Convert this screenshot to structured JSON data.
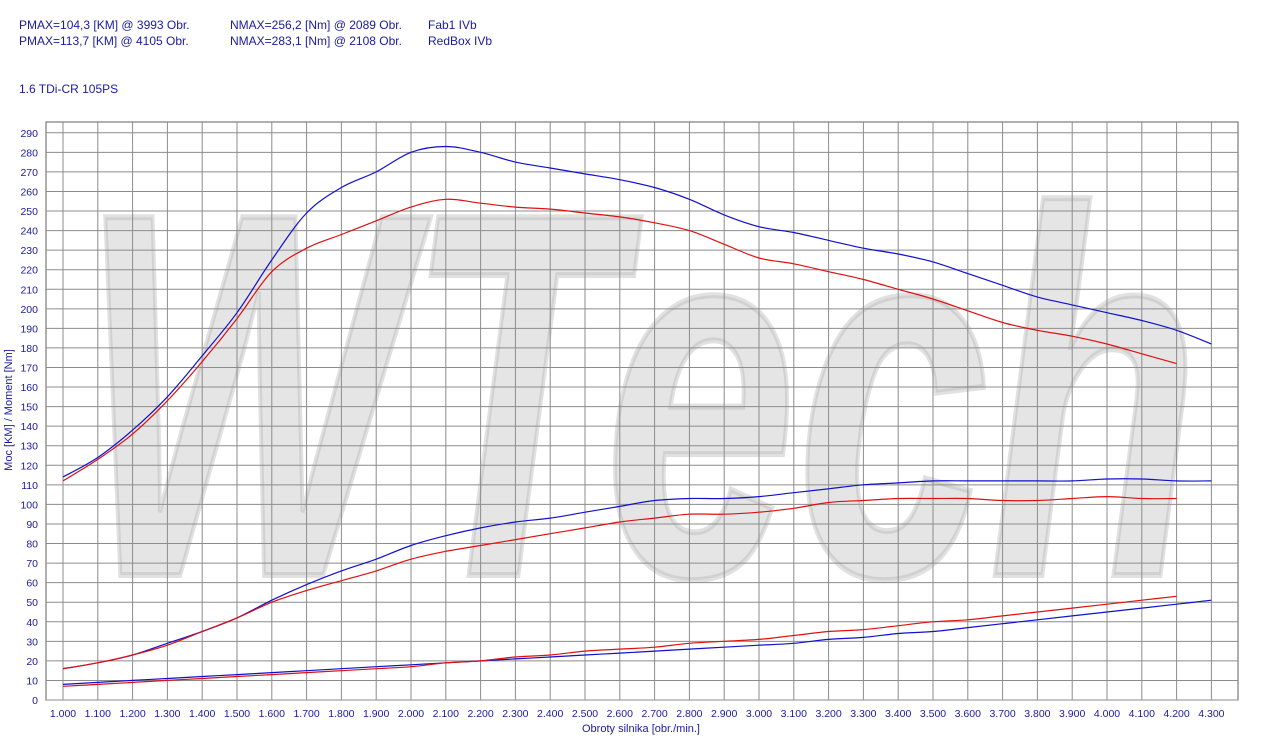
{
  "header": {
    "row1": {
      "pmax": "PMAX=104,3 [KM] @ 3993 Obr.",
      "nmax": "NMAX=256,2 [Nm] @ 2089 Obr.",
      "name": "Fab1 IVb"
    },
    "row2": {
      "pmax": "PMAX=113,7 [KM] @ 4105 Obr.",
      "nmax": "NMAX=283,1 [Nm] @ 2108 Obr.",
      "name": "RedBox IVb"
    },
    "engine": "1.6 TDi-CR 105PS"
  },
  "chart_data": {
    "type": "line",
    "xlabel": "Obroty silnika [obr./min.]",
    "ylabel": "Moc [KM] / Moment [Nm]",
    "xlim": [
      1.0,
      4.3
    ],
    "ylim": [
      0,
      290
    ],
    "x_ticks": [
      "1.000",
      "1.100",
      "1.200",
      "1.300",
      "1.400",
      "1.500",
      "1.600",
      "1.700",
      "1.800",
      "1.900",
      "2.000",
      "2.100",
      "2.200",
      "2.300",
      "2.400",
      "2.500",
      "2.600",
      "2.700",
      "2.800",
      "2.900",
      "3.000",
      "3.100",
      "3.200",
      "3.300",
      "3.400",
      "3.500",
      "3.600",
      "3.700",
      "3.800",
      "3.900",
      "4.000",
      "4.100",
      "4.200",
      "4.300"
    ],
    "y_ticks": [
      "0",
      "10",
      "20",
      "30",
      "40",
      "50",
      "60",
      "70",
      "80",
      "90",
      "100",
      "110",
      "120",
      "130",
      "140",
      "150",
      "160",
      "170",
      "180",
      "190",
      "200",
      "210",
      "220",
      "230",
      "240",
      "250",
      "260",
      "270",
      "280",
      "290"
    ],
    "grid": true,
    "watermark": "WTech",
    "colors": {
      "red": "#e01010",
      "blue": "#1010d0",
      "grid": "#8c8c8c",
      "axis_text": "#1a1aa0"
    },
    "series": [
      {
        "color": "#1010d0",
        "x": [
          1.0,
          1.1,
          1.2,
          1.3,
          1.4,
          1.5,
          1.6,
          1.7,
          1.8,
          1.9,
          2.0,
          2.1,
          2.2,
          2.3,
          2.4,
          2.5,
          2.6,
          2.7,
          2.8,
          2.9,
          3.0,
          3.1,
          3.2,
          3.3,
          3.4,
          3.5,
          3.6,
          3.7,
          3.8,
          3.9,
          4.0,
          4.1,
          4.2,
          4.3
        ],
        "y": [
          114,
          124,
          138,
          155,
          176,
          198,
          225,
          249,
          262,
          270,
          280,
          283,
          280,
          275,
          272,
          269,
          266,
          262,
          256,
          248,
          242,
          239,
          235,
          231,
          228,
          224,
          218,
          212,
          206,
          202,
          198,
          194,
          189,
          182
        ]
      },
      {
        "color": "#e01010",
        "x": [
          1.0,
          1.1,
          1.2,
          1.3,
          1.4,
          1.5,
          1.6,
          1.7,
          1.8,
          1.9,
          2.0,
          2.1,
          2.2,
          2.3,
          2.4,
          2.5,
          2.6,
          2.7,
          2.8,
          2.9,
          3.0,
          3.1,
          3.2,
          3.3,
          3.4,
          3.5,
          3.6,
          3.7,
          3.8,
          3.9,
          4.0,
          4.1,
          4.2
        ],
        "y": [
          112,
          123,
          136,
          153,
          173,
          195,
          219,
          231,
          238,
          245,
          252,
          256,
          254,
          252,
          251,
          249,
          247,
          244,
          240,
          233,
          226,
          223,
          219,
          215,
          210,
          205,
          199,
          193,
          189,
          186,
          182,
          177,
          172
        ]
      },
      {
        "color": "#1010d0",
        "x": [
          1.0,
          1.1,
          1.2,
          1.3,
          1.4,
          1.5,
          1.6,
          1.7,
          1.8,
          1.9,
          2.0,
          2.1,
          2.2,
          2.3,
          2.4,
          2.5,
          2.6,
          2.7,
          2.8,
          2.9,
          3.0,
          3.1,
          3.2,
          3.3,
          3.4,
          3.5,
          3.6,
          3.7,
          3.8,
          3.9,
          4.0,
          4.1,
          4.2,
          4.3
        ],
        "y": [
          16,
          19,
          23,
          29,
          35,
          42,
          51,
          59,
          66,
          72,
          79,
          84,
          88,
          91,
          93,
          96,
          99,
          102,
          103,
          103,
          104,
          106,
          108,
          110,
          111,
          112,
          112,
          112,
          112,
          112,
          113,
          113,
          112,
          112
        ]
      },
      {
        "color": "#e01010",
        "x": [
          1.0,
          1.1,
          1.2,
          1.3,
          1.4,
          1.5,
          1.6,
          1.7,
          1.8,
          1.9,
          2.0,
          2.1,
          2.2,
          2.3,
          2.4,
          2.5,
          2.6,
          2.7,
          2.8,
          2.9,
          3.0,
          3.1,
          3.2,
          3.3,
          3.4,
          3.5,
          3.6,
          3.7,
          3.8,
          3.9,
          4.0,
          4.1,
          4.2
        ],
        "y": [
          16,
          19,
          23,
          28,
          35,
          42,
          50,
          56,
          61,
          66,
          72,
          76,
          79,
          82,
          85,
          88,
          91,
          93,
          95,
          95,
          96,
          98,
          101,
          102,
          103,
          103,
          103,
          102,
          102,
          103,
          104,
          103,
          103
        ]
      },
      {
        "color": "#1010d0",
        "x": [
          1.0,
          1.1,
          1.2,
          1.3,
          1.4,
          1.5,
          1.6,
          1.7,
          1.8,
          1.9,
          2.0,
          2.1,
          2.2,
          2.3,
          2.4,
          2.5,
          2.6,
          2.7,
          2.8,
          2.9,
          3.0,
          3.1,
          3.2,
          3.3,
          3.4,
          3.5,
          3.6,
          3.7,
          3.8,
          3.9,
          4.0,
          4.1,
          4.2,
          4.3
        ],
        "y": [
          8,
          9,
          10,
          11,
          12,
          13,
          14,
          15,
          16,
          17,
          18,
          19,
          20,
          21,
          22,
          23,
          24,
          25,
          26,
          27,
          28,
          29,
          31,
          32,
          34,
          35,
          37,
          39,
          41,
          43,
          45,
          47,
          49,
          51
        ]
      },
      {
        "color": "#e01010",
        "x": [
          1.0,
          1.1,
          1.2,
          1.3,
          1.4,
          1.5,
          1.6,
          1.7,
          1.8,
          1.9,
          2.0,
          2.1,
          2.2,
          2.3,
          2.4,
          2.5,
          2.6,
          2.7,
          2.8,
          2.9,
          3.0,
          3.1,
          3.2,
          3.3,
          3.4,
          3.5,
          3.6,
          3.7,
          3.8,
          3.9,
          4.0,
          4.1,
          4.2
        ],
        "y": [
          7,
          8,
          9,
          10,
          11,
          12,
          13,
          14,
          15,
          16,
          17,
          19,
          20,
          22,
          23,
          25,
          26,
          27,
          29,
          30,
          31,
          33,
          35,
          36,
          38,
          40,
          41,
          43,
          45,
          47,
          49,
          51,
          53
        ]
      }
    ]
  }
}
